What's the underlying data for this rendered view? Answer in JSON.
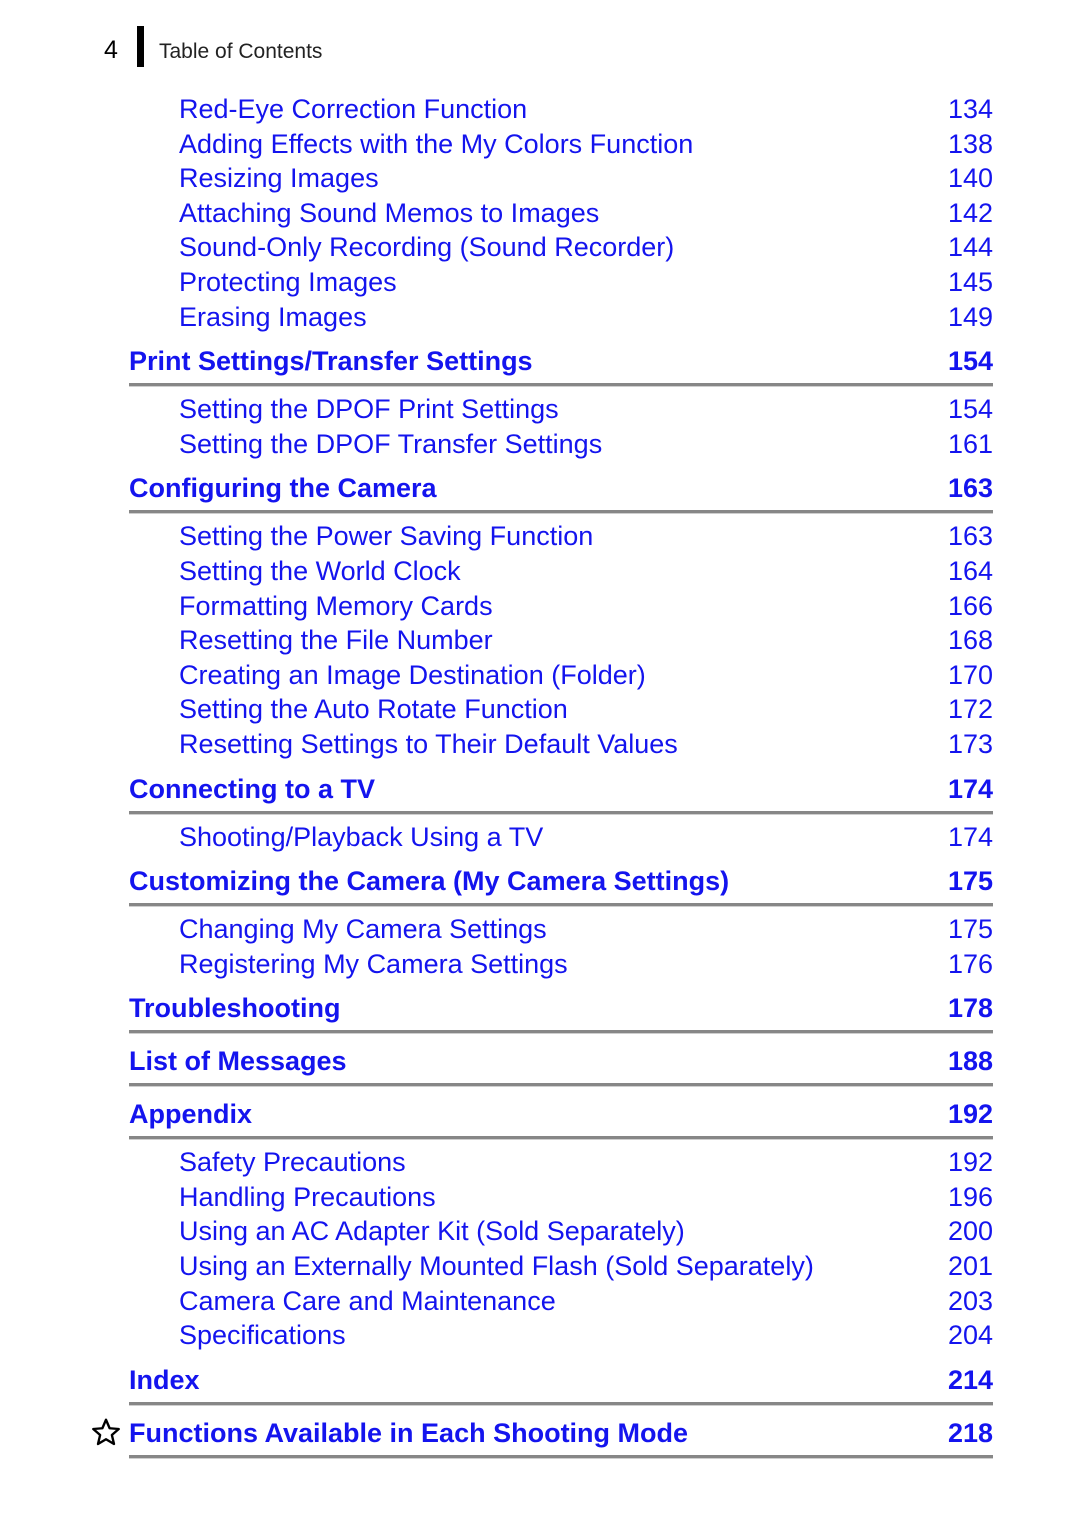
{
  "header": {
    "page_number": "4",
    "title": "Table of Contents"
  },
  "colors": {
    "link_blue": "#1414ee",
    "rule_gray": "#878787",
    "header_black": "#000000"
  },
  "toc": {
    "leading_entries": [
      {
        "label": "Red-Eye Correction Function",
        "page": "134"
      },
      {
        "label": "Adding Effects with the My Colors Function",
        "page": "138"
      },
      {
        "label": "Resizing Images",
        "page": "140"
      },
      {
        "label": "Attaching Sound Memos to Images",
        "page": "142"
      },
      {
        "label": "Sound-Only Recording (Sound Recorder)",
        "page": "144"
      },
      {
        "label": "Protecting Images",
        "page": "145"
      },
      {
        "label": "Erasing Images",
        "page": "149"
      }
    ],
    "sections": [
      {
        "title": "Print Settings/Transfer Settings",
        "page": "154",
        "starred": false,
        "entries": [
          {
            "label": "Setting the DPOF Print Settings",
            "page": "154"
          },
          {
            "label": "Setting the DPOF Transfer Settings",
            "page": "161"
          }
        ]
      },
      {
        "title": "Configuring the Camera",
        "page": "163",
        "starred": false,
        "entries": [
          {
            "label": "Setting the Power Saving Function",
            "page": "163"
          },
          {
            "label": "Setting the World Clock",
            "page": "164"
          },
          {
            "label": "Formatting Memory Cards",
            "page": "166"
          },
          {
            "label": "Resetting the File Number",
            "page": "168"
          },
          {
            "label": "Creating an Image Destination (Folder)",
            "page": "170"
          },
          {
            "label": "Setting the Auto Rotate Function",
            "page": "172"
          },
          {
            "label": "Resetting Settings to Their Default Values",
            "page": "173"
          }
        ]
      },
      {
        "title": "Connecting to a TV",
        "page": "174",
        "starred": false,
        "entries": [
          {
            "label": "Shooting/Playback Using a TV",
            "page": "174"
          }
        ]
      },
      {
        "title": "Customizing the Camera (My Camera Settings)",
        "page": "175",
        "starred": false,
        "entries": [
          {
            "label": "Changing My Camera Settings",
            "page": "175"
          },
          {
            "label": "Registering My Camera Settings",
            "page": "176"
          }
        ]
      },
      {
        "title": "Troubleshooting",
        "page": "178",
        "starred": false,
        "entries": []
      },
      {
        "title": "List of Messages",
        "page": "188",
        "starred": false,
        "entries": []
      },
      {
        "title": "Appendix",
        "page": "192",
        "starred": false,
        "entries": [
          {
            "label": "Safety Precautions",
            "page": "192"
          },
          {
            "label": "Handling Precautions",
            "page": "196"
          },
          {
            "label": "Using an AC Adapter Kit (Sold Separately)",
            "page": "200"
          },
          {
            "label": "Using an Externally Mounted Flash (Sold Separately)",
            "page": "201"
          },
          {
            "label": "Camera Care and Maintenance",
            "page": "203"
          },
          {
            "label": "Specifications",
            "page": "204"
          }
        ]
      },
      {
        "title": "Index",
        "page": "214",
        "starred": false,
        "entries": []
      },
      {
        "title": "Functions Available in Each Shooting Mode",
        "page": "218",
        "starred": true,
        "star_icon": "star-outline-icon",
        "entries": []
      }
    ]
  }
}
